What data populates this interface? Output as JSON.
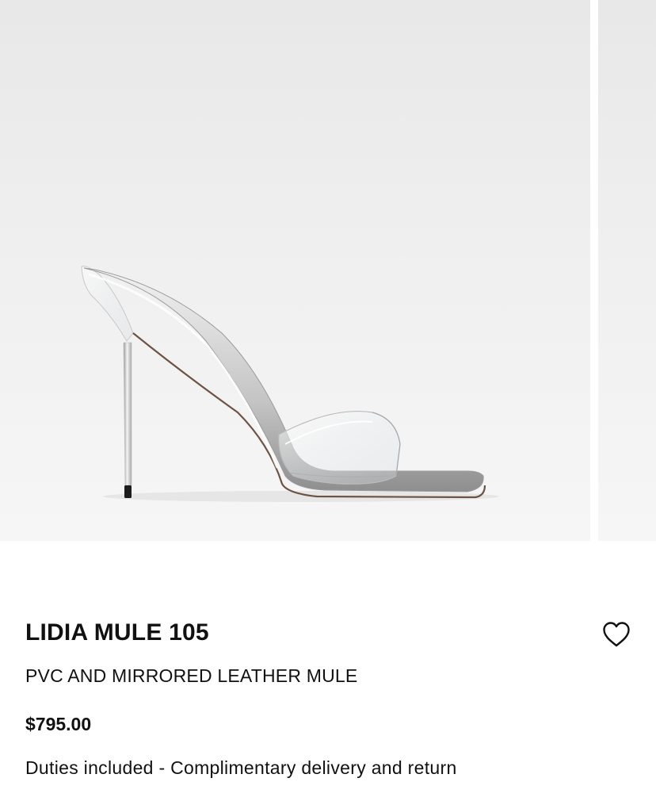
{
  "gallery": {
    "image_alt": "Clear PVC stiletto mule with mirrored silver leather sole",
    "slide_count_visible": 2
  },
  "product": {
    "title": "LIDIA MULE 105",
    "subtitle": "PVC AND MIRRORED LEATHER MULE",
    "price": "$795.00",
    "delivery_note": "Duties included - Complimentary delivery and return"
  },
  "icons": {
    "wishlist": "heart-outline-icon"
  },
  "colors": {
    "text": "#111111",
    "image_background": "#eeeeee",
    "page_background": "#ffffff"
  }
}
